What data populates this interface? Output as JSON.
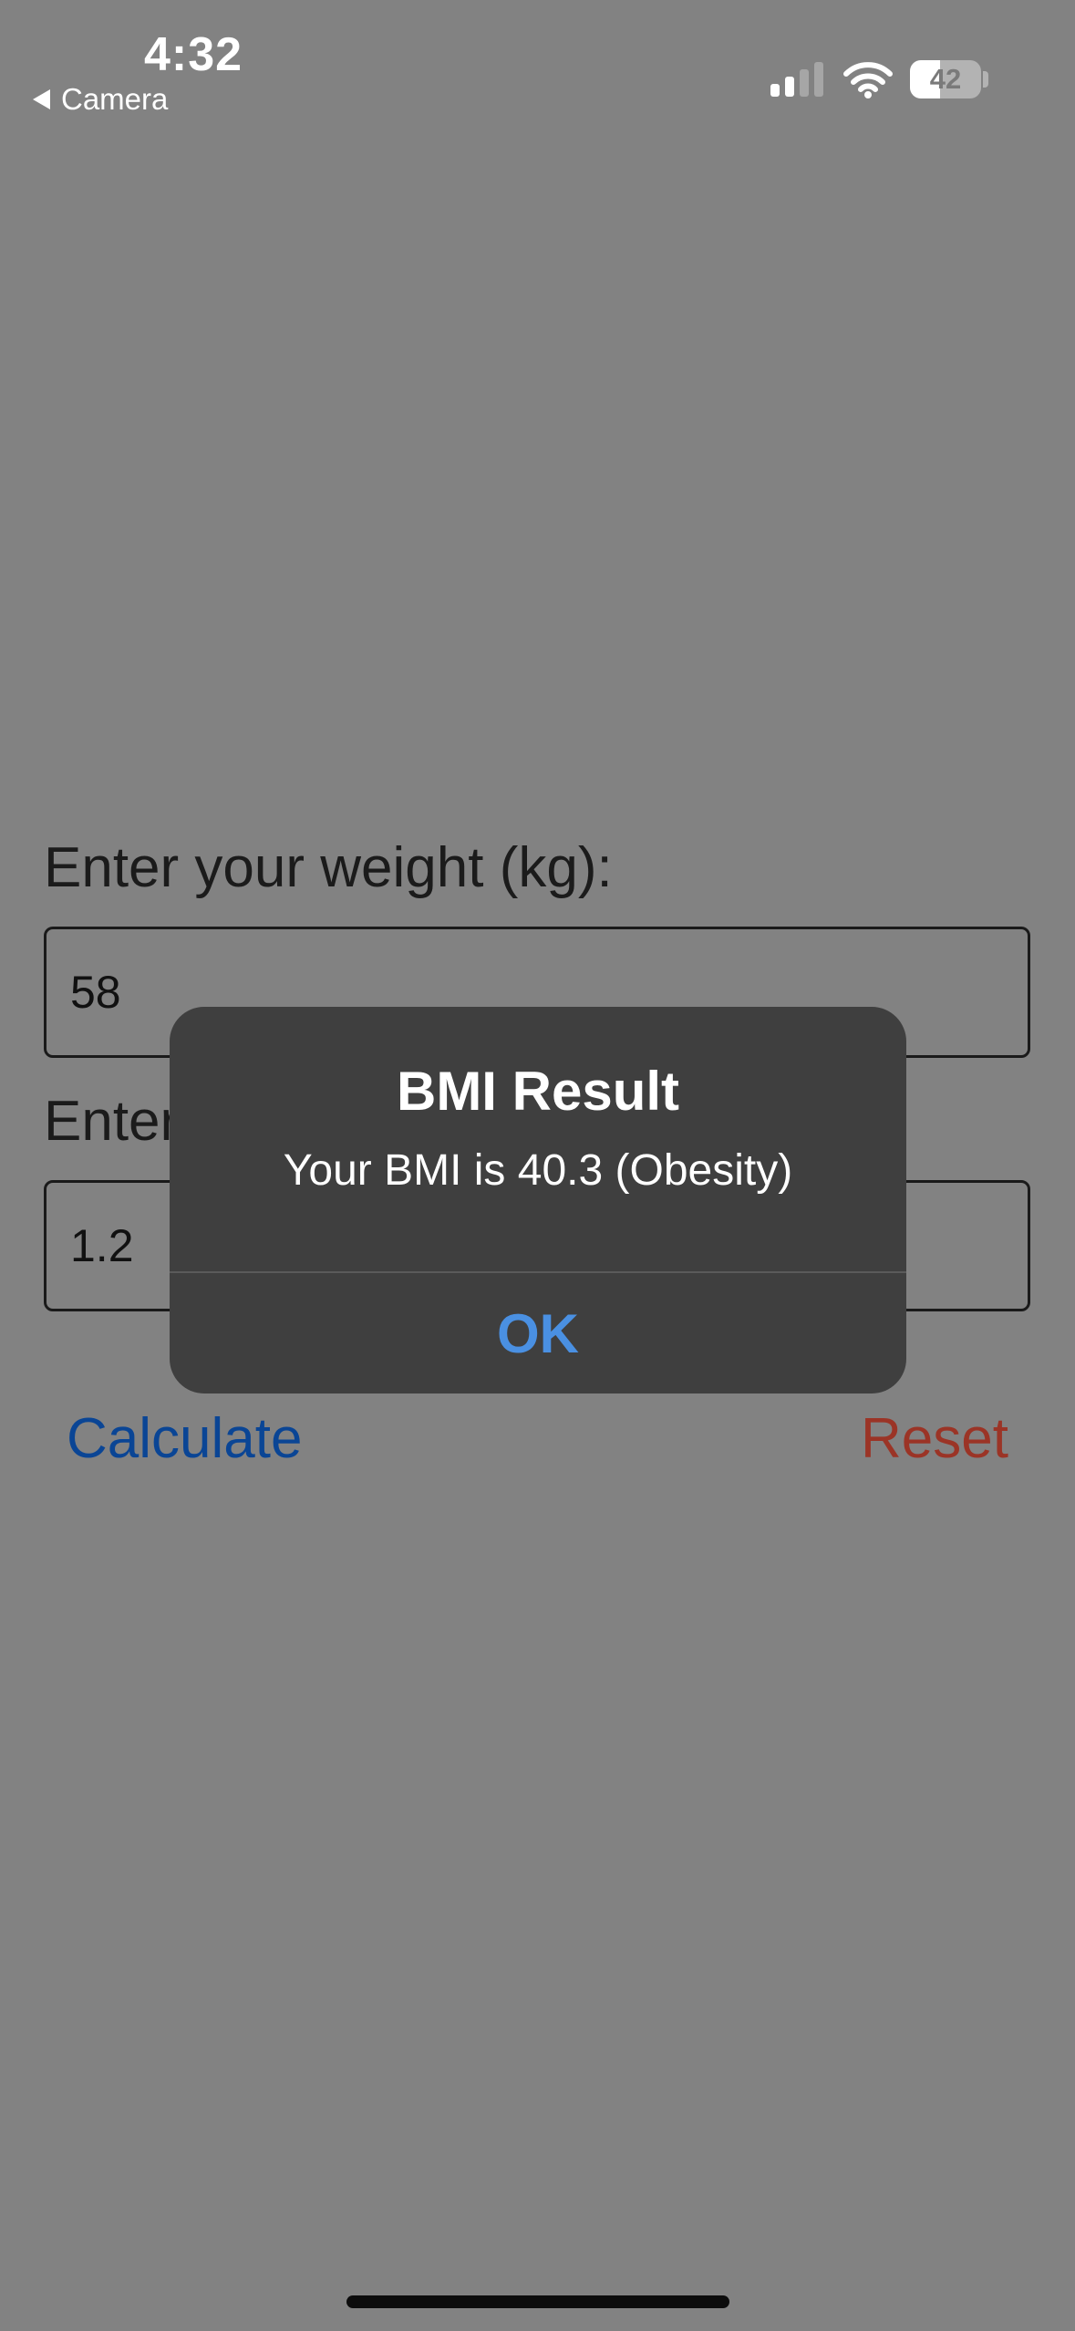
{
  "status_bar": {
    "time": "4:32",
    "back_label": "Camera",
    "battery_percent": "42",
    "battery_level": 0.42,
    "signal_bars_active": 2,
    "signal_bars_total": 4
  },
  "form": {
    "weight_label": "Enter your weight (kg):",
    "weight_value": "58",
    "height_label": "Enter",
    "height_value": "1.2",
    "calculate_label": "Calculate",
    "reset_label": "Reset"
  },
  "alert": {
    "title": "BMI Result",
    "message": "Your BMI is 40.3 (Obesity)",
    "ok_label": "OK"
  },
  "colors": {
    "background": "#828282",
    "calculate": "#0a4595",
    "reset": "#9b3426",
    "alert_bg": "#3f3f3f",
    "alert_button": "#4a90e2"
  }
}
